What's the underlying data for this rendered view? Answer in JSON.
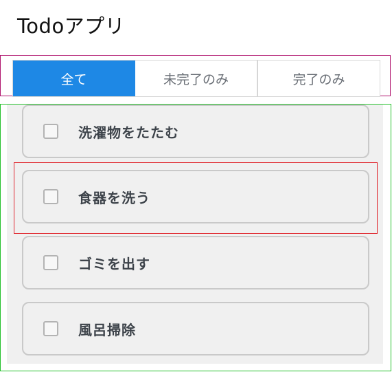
{
  "app": {
    "title": "Todoアプリ"
  },
  "filters": {
    "tabs": [
      {
        "label": "全て",
        "active": true
      },
      {
        "label": "未完了のみ",
        "active": false
      },
      {
        "label": "完了のみ",
        "active": false
      }
    ]
  },
  "todos": [
    {
      "label": "洗濯物をたたむ",
      "checked": false
    },
    {
      "label": "食器を洗う",
      "checked": false
    },
    {
      "label": "ゴミを出す",
      "checked": false
    },
    {
      "label": "風呂掃除",
      "checked": false
    }
  ],
  "colors": {
    "accent": "#1e88e5",
    "filter_outline": "#b0146e",
    "list_outline": "#23c02a",
    "highlight_outline": "#e0262e"
  }
}
